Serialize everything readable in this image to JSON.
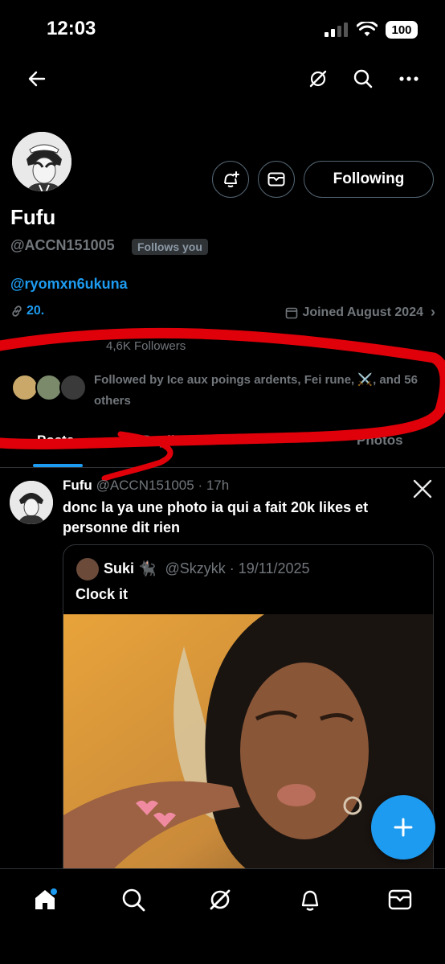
{
  "status_bar": {
    "time": "12:03",
    "battery": "100"
  },
  "profile": {
    "name": "Fufu",
    "handle": "@ACCN151005",
    "follows_you": "Follows you",
    "bio_link": "@ryomxn6ukuna",
    "url": "20.",
    "joined": "Joined August 2024",
    "stats_partial": "4,6K Followers",
    "followed_by": "Followed by Ice aux poings ardents, Fei rune, ⚔️, and 56 others",
    "follow_button": "Following"
  },
  "tabs": [
    {
      "label": "Posts",
      "active": true
    },
    {
      "label": "Replies",
      "active": false
    },
    {
      "label": "Photos",
      "active": false
    }
  ],
  "post": {
    "author_name": "Fufu",
    "author_handle": "@ACCN151005",
    "time": "· 17h",
    "text": "donc la ya une photo ia qui a fait 20k likes et personne dit rien",
    "quote": {
      "author_name": "Suki 🐈‍⬛",
      "author_handle": "@Skzykk",
      "date": "· 19/11/2025",
      "text": "Clock it"
    }
  },
  "icons": {
    "back": "back-arrow-icon",
    "grok": "grok-icon",
    "search": "search-icon",
    "more": "more-icon",
    "notify": "bell-plus-icon",
    "message": "envelope-icon",
    "x_logo": "x-logo-icon",
    "compose": "plus-icon"
  },
  "colors": {
    "accent": "#1d9bf0",
    "muted": "#71767b",
    "annotation": "#e0000a"
  }
}
